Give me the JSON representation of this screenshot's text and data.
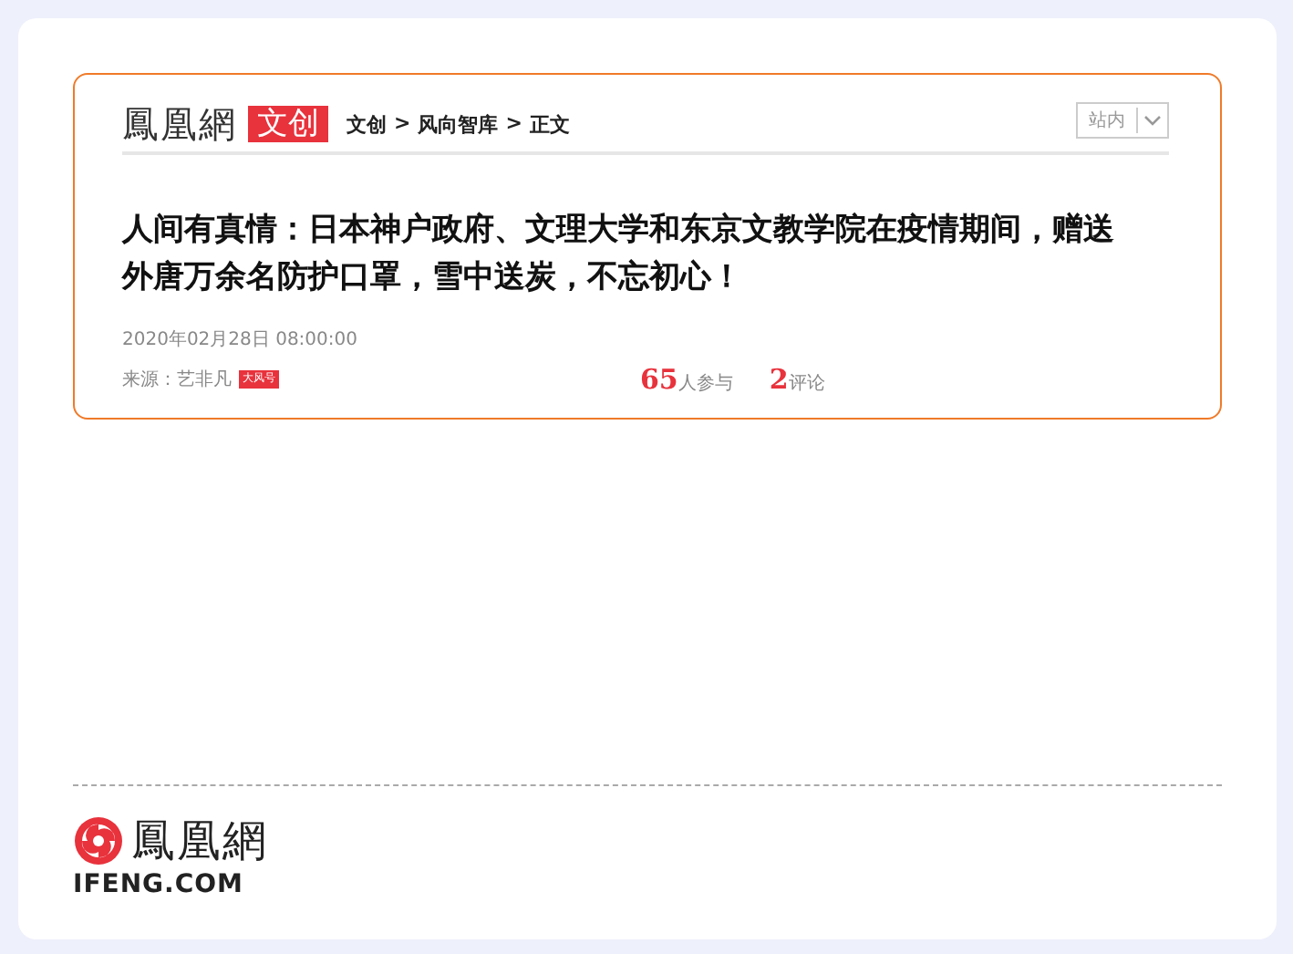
{
  "header": {
    "brand": "鳳凰網",
    "channel": "文创",
    "breadcrumb": [
      "文创",
      "风向智库",
      "正文"
    ],
    "separator": ">",
    "search_scope": "站内"
  },
  "article": {
    "title": "人间有真情：日本神户政府、文理大学和东京文教学院在疫情期间，赠送外唐万余名防护口罩，雪中送炭，不忘初心！",
    "date": "2020年02月28日 08:00:00",
    "source": "来源：艺非凡",
    "source_badge": "大风号",
    "participants_count": "65",
    "participants_label": "人参与",
    "comments_count": "2",
    "comments_label": "评论"
  },
  "footer": {
    "logo_text": "鳳凰網",
    "logo_domain": "IFENG.COM"
  }
}
